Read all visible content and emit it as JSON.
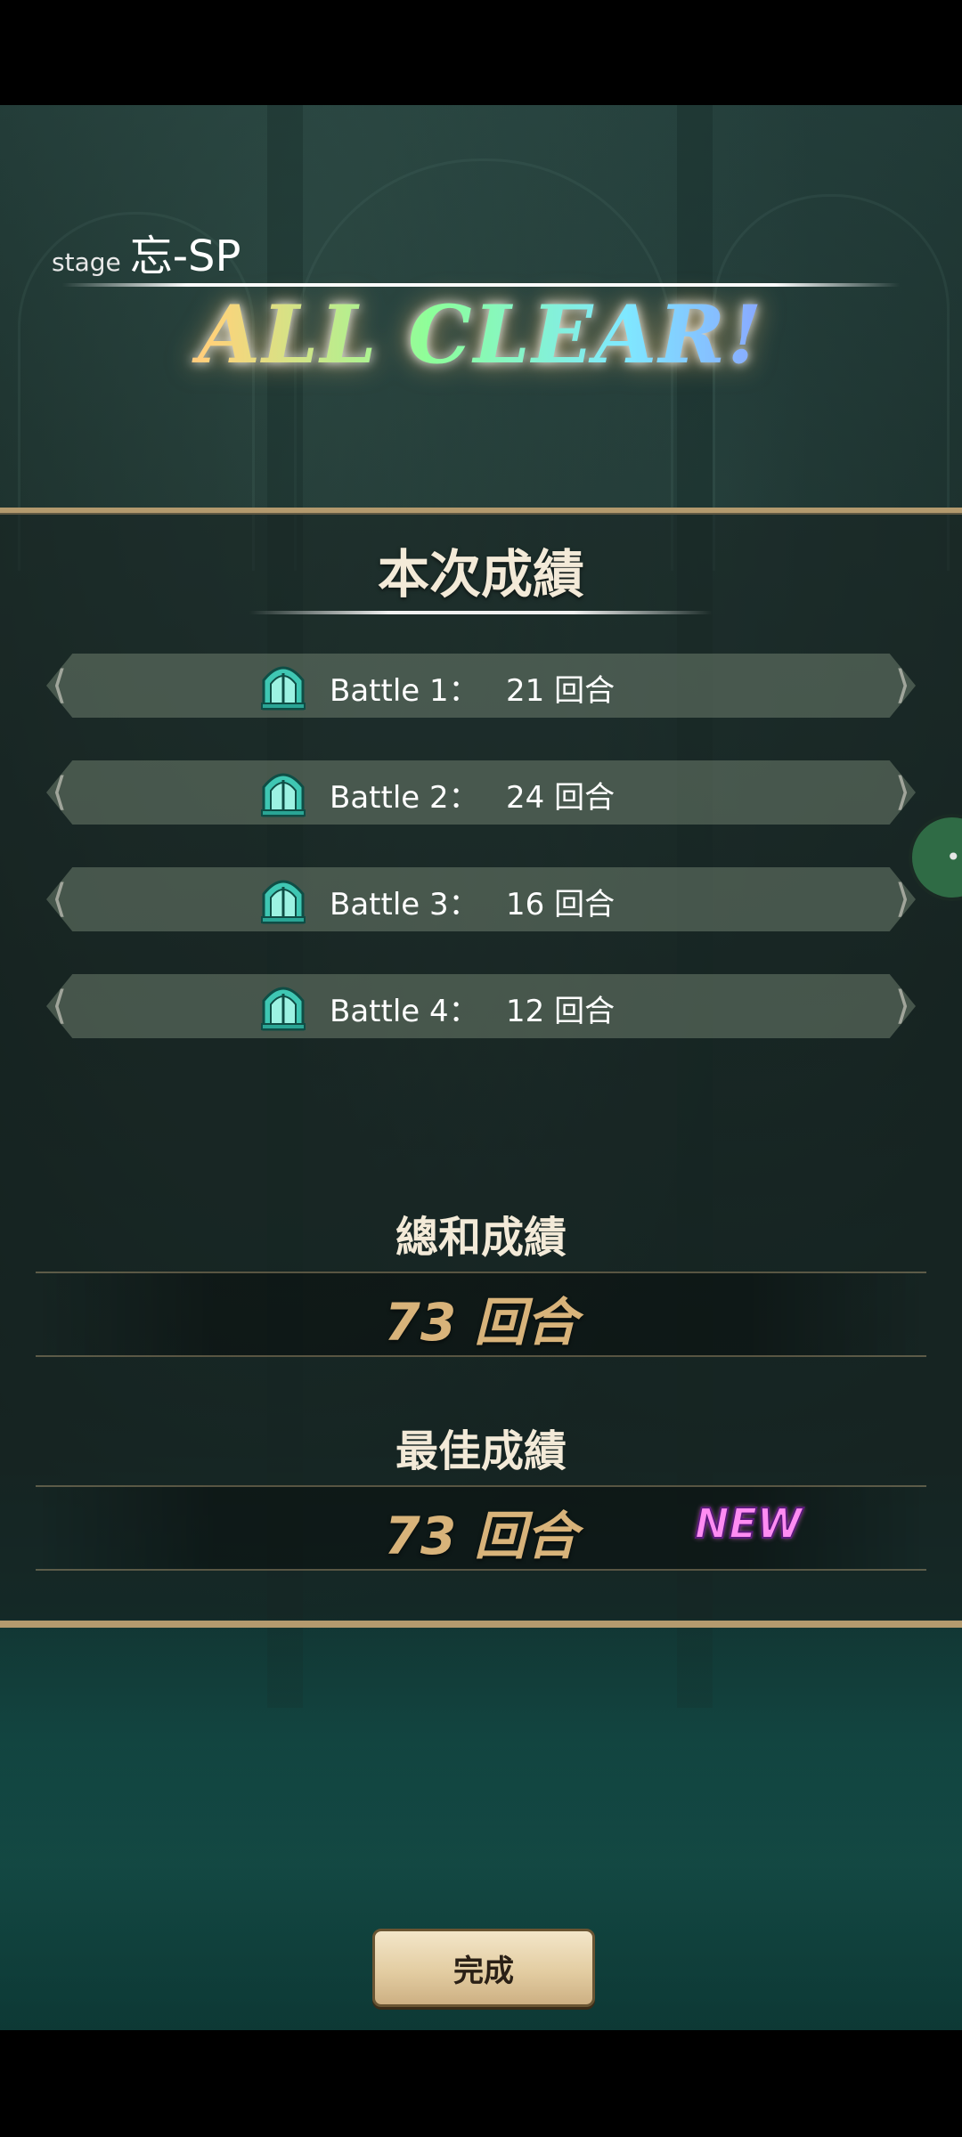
{
  "stage": {
    "label": "stage",
    "name": "忘-SP"
  },
  "banner": {
    "text": "ALL CLEAR!"
  },
  "current_results": {
    "title": "本次成績",
    "battles": [
      {
        "label": "Battle 1：",
        "value": "21 回合"
      },
      {
        "label": "Battle 2：",
        "value": "24 回合"
      },
      {
        "label": "Battle 3：",
        "value": "16 回合"
      },
      {
        "label": "Battle 4：",
        "value": "12 回合"
      }
    ]
  },
  "total": {
    "title": "總和成績",
    "value": "73 回合"
  },
  "best": {
    "title": "最佳成績",
    "value": "73 回合",
    "badge": "NEW"
  },
  "done_button": {
    "label": "完成"
  },
  "colors": {
    "gold": "#b39a6e",
    "score": "#d8b37a",
    "new_badge": "#ff8cf2",
    "gate_icon": "#3fc7b3"
  },
  "icons": {
    "battle": "gate-icon",
    "side": "more-icon"
  }
}
